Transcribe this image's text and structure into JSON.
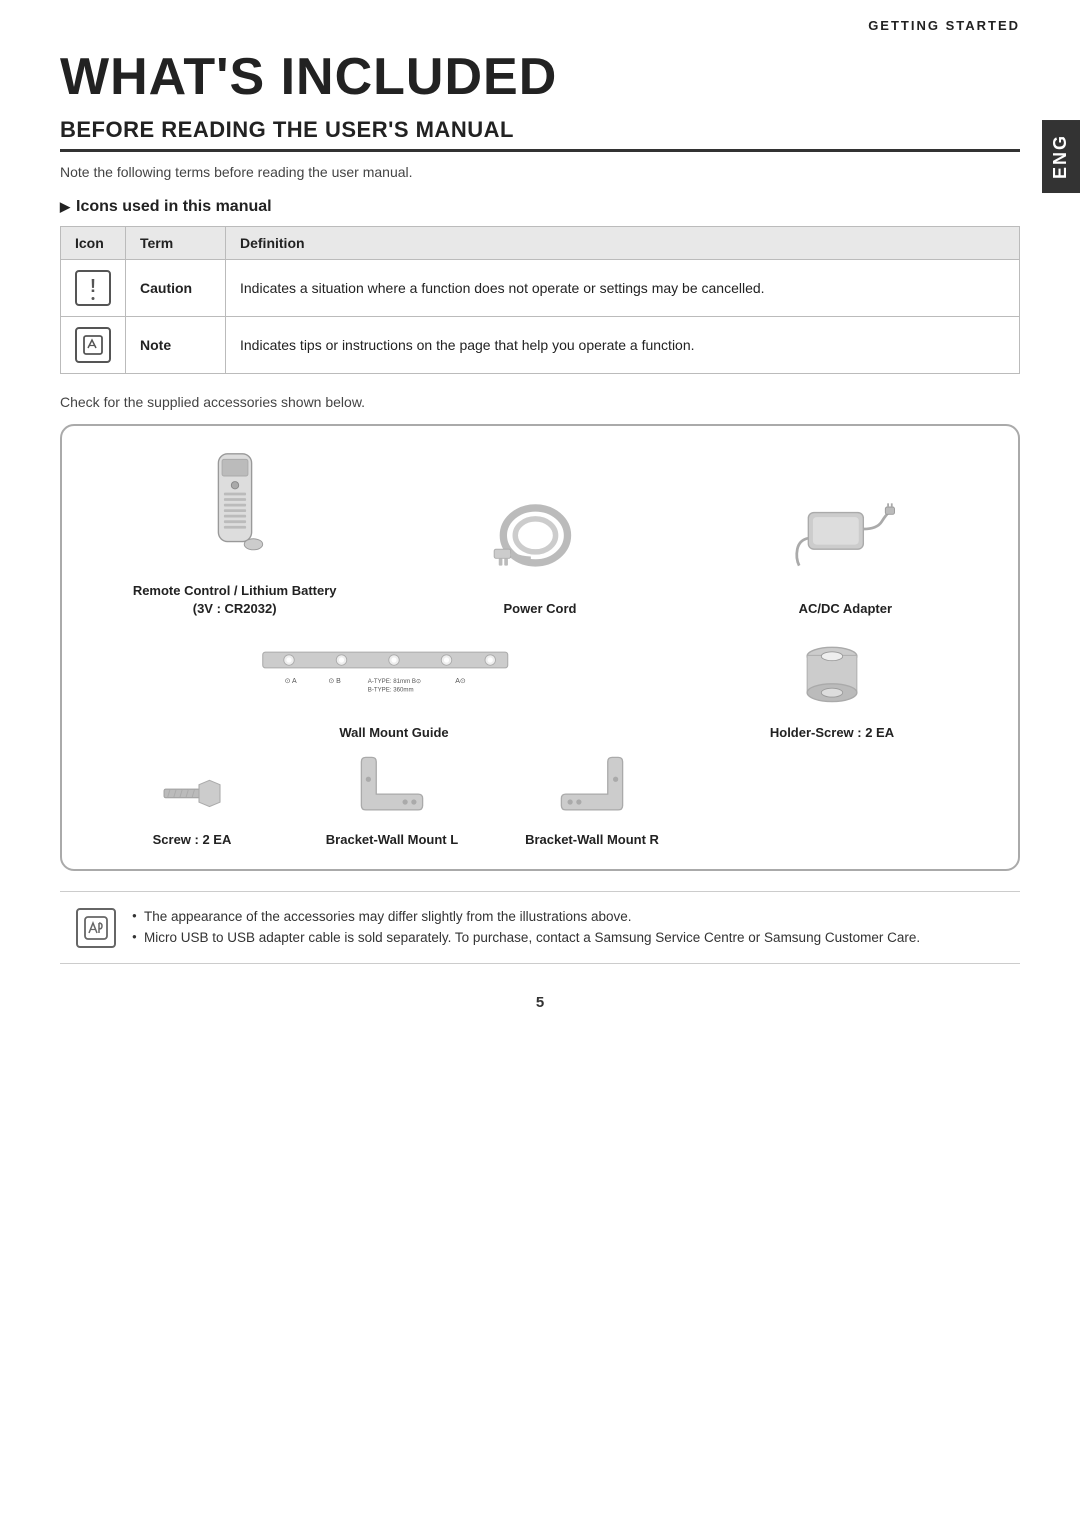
{
  "header": {
    "section_label": "GETTING STARTED"
  },
  "side_tab": {
    "label": "ENG"
  },
  "page": {
    "title": "WHAT'S INCLUDED",
    "section_heading": "BEFORE READING THE USER'S MANUAL",
    "intro_text": "Note the following terms before reading the user manual.",
    "icons_heading": "Icons used in this manual"
  },
  "icon_table": {
    "columns": [
      "Icon",
      "Term",
      "Definition"
    ],
    "rows": [
      {
        "icon_type": "caution",
        "term": "Caution",
        "definition": "Indicates a situation where a function does not operate or settings may be cancelled."
      },
      {
        "icon_type": "note",
        "term": "Note",
        "definition": "Indicates tips or instructions on the page that help you operate a function."
      }
    ]
  },
  "accessories": {
    "check_text": "Check for the supplied accessories shown below.",
    "items": [
      {
        "id": "remote",
        "label": "Remote Control / Lithium Battery\n(3V : CR2032)"
      },
      {
        "id": "power_cord",
        "label": "Power Cord"
      },
      {
        "id": "adapter",
        "label": "AC/DC Adapter"
      },
      {
        "id": "wall_mount",
        "label": "Wall Mount Guide"
      },
      {
        "id": "holder_screw",
        "label": "Holder-Screw : 2 EA"
      },
      {
        "id": "screw",
        "label": "Screw : 2 EA"
      },
      {
        "id": "bracket_l",
        "label": "Bracket-Wall Mount L"
      },
      {
        "id": "bracket_r",
        "label": "Bracket-Wall Mount R"
      }
    ]
  },
  "note_box": {
    "bullets": [
      "The appearance of the accessories may differ slightly from the illustrations above.",
      "Micro USB to USB adapter cable is sold separately. To purchase, contact a Samsung Service Centre or Samsung Customer Care."
    ]
  },
  "page_number": "5"
}
